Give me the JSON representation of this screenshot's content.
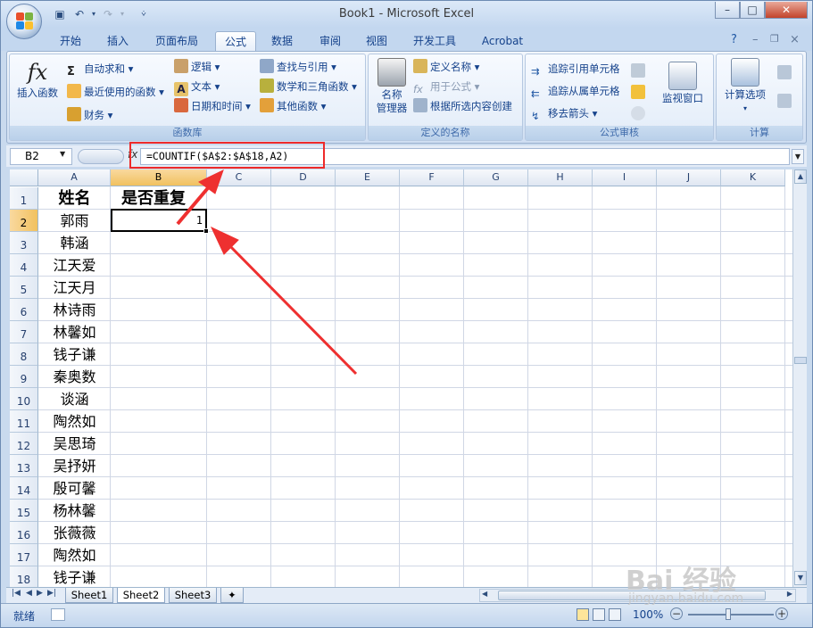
{
  "window": {
    "title": "Book1 - Microsoft Excel",
    "minimize": "–",
    "maximize": "□",
    "close": "✕"
  },
  "tabs": [
    {
      "label": "开始"
    },
    {
      "label": "插入"
    },
    {
      "label": "页面布局"
    },
    {
      "label": "公式"
    },
    {
      "label": "数据"
    },
    {
      "label": "审阅"
    },
    {
      "label": "视图"
    },
    {
      "label": "开发工具"
    },
    {
      "label": "Acrobat"
    }
  ],
  "active_tab": "公式",
  "ribbon": {
    "function_library": {
      "label": "函数库",
      "insert_function": "插入函数",
      "autosum": "自动求和",
      "recent": "最近使用的函数",
      "financial": "财务",
      "logical": "逻辑",
      "text": "文本",
      "datetime": "日期和时间",
      "lookup": "查找与引用",
      "math": "数学和三角函数",
      "more": "其他函数"
    },
    "defined_names": {
      "label": "定义的名称",
      "name_manager_1": "名称",
      "name_manager_2": "管理器",
      "define_name": "定义名称",
      "use_in_formula": "用于公式",
      "create_from_selection": "根据所选内容创建"
    },
    "formula_auditing": {
      "label": "公式审核",
      "trace_precedents": "追踪引用单元格",
      "trace_dependents": "追踪从属单元格",
      "remove_arrows": "移去箭头",
      "watch_window": "监视窗口"
    },
    "calculation": {
      "label": "计算",
      "calc_options": "计算选项"
    }
  },
  "formula_bar": {
    "name_box": "B2",
    "fx": "fx",
    "formula": "=COUNTIF($A$2:$A$18,A2)"
  },
  "columns": [
    "A",
    "B",
    "C",
    "D",
    "E",
    "F",
    "G",
    "H",
    "I",
    "J",
    "K"
  ],
  "rows": [
    "1",
    "2",
    "3",
    "4",
    "5",
    "6",
    "7",
    "8",
    "9",
    "10",
    "11",
    "12",
    "13",
    "14",
    "15",
    "16",
    "17",
    "18"
  ],
  "cells": {
    "A1": "姓名",
    "B1": "是否重复",
    "B2": "1",
    "A_values": [
      "郭雨",
      "韩涵",
      "江天爱",
      "江天月",
      "林诗雨",
      "林馨如",
      "钱子谦",
      "秦奥数",
      "谈涵",
      "陶然如",
      "吴思琦",
      "吴抒妍",
      "殷可馨",
      "杨林馨",
      "张薇薇",
      "陶然如",
      "钱子谦"
    ]
  },
  "sheets": [
    {
      "label": "Sheet1"
    },
    {
      "label": "Sheet2"
    },
    {
      "label": "Sheet3"
    }
  ],
  "active_sheet": "Sheet2",
  "status": {
    "ready": "就绪",
    "zoom": "100%"
  },
  "watermark": {
    "brand": "Bai 经验",
    "url": "jingyan.baidu.com"
  },
  "colors": {
    "annotation": "#ee2a2a",
    "selected_header": "#f1c15f"
  }
}
